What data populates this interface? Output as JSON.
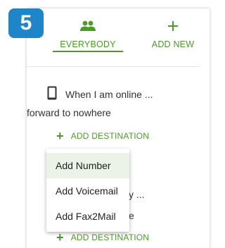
{
  "step_badge": "5",
  "tabs": [
    {
      "label": "EVERYBODY",
      "icon": "people-icon",
      "active": true
    },
    {
      "label": "ADD NEW",
      "icon": "plus-icon",
      "active": false
    }
  ],
  "rule": {
    "condition_icon": "phone-icon",
    "condition_text": "When I am online ...",
    "forward_text": "forward to nowhere",
    "add_destination": "ADD DESTINATION",
    "partial_condition_text": "y ...",
    "partial_forward_text": "e",
    "add_destination_2": "ADD DESTINATION"
  },
  "dropdown_menu": {
    "items": [
      {
        "label": "Add Number",
        "highlighted": true
      },
      {
        "label": "Add Voicemail",
        "highlighted": false
      },
      {
        "label": "Add Fax2Mail",
        "highlighted": false
      }
    ]
  },
  "colors": {
    "accent_green": "#4c9a2a",
    "badge_blue": "#1f85c9",
    "menu_highlight": "#eaf3e6"
  }
}
